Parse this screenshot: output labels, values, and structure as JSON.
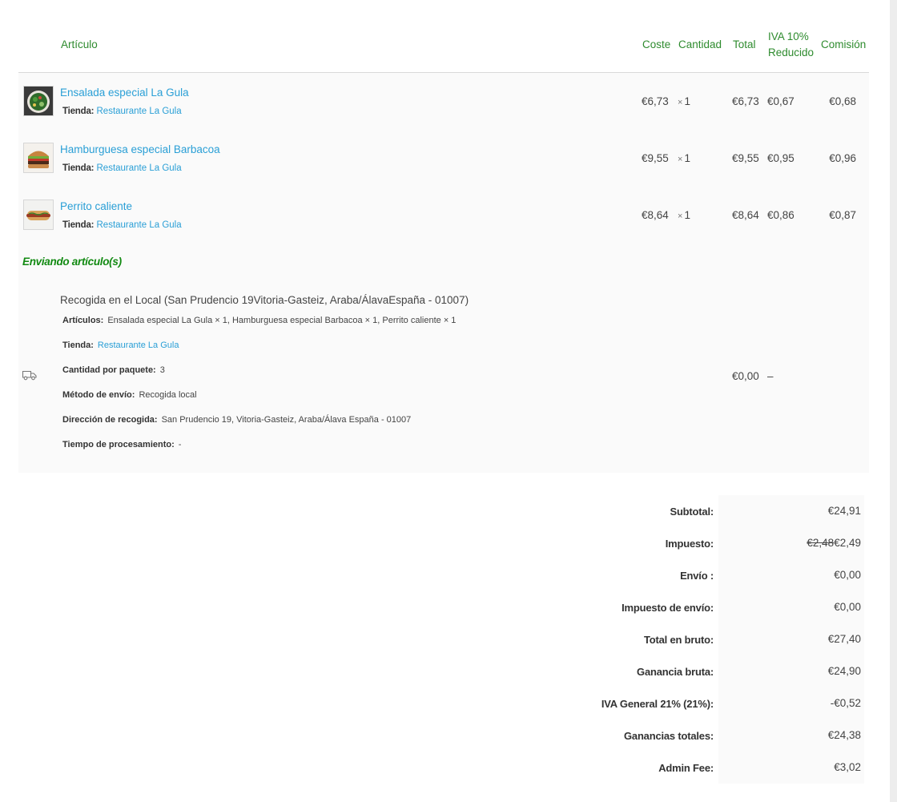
{
  "table": {
    "headers": {
      "item": "Artículo",
      "cost": "Coste",
      "quantity": "Cantidad",
      "total": "Total",
      "tax_line1": "IVA 10%",
      "tax_line2": "Reducido",
      "commission": "Comisión"
    },
    "store_label": "Tienda:",
    "qty_prefix": "×",
    "items": [
      {
        "name": "Ensalada especial La Gula",
        "store": "Restaurante La Gula",
        "cost": "€6,73",
        "qty": "1",
        "total": "€6,73",
        "tax": "€0,67",
        "commission": "€0,68",
        "thumb": "salad-thumbnail"
      },
      {
        "name": "Hamburguesa especial Barbacoa",
        "store": "Restaurante La Gula",
        "cost": "€9,55",
        "qty": "1",
        "total": "€9,55",
        "tax": "€0,95",
        "commission": "€0,96",
        "thumb": "burger-thumbnail"
      },
      {
        "name": "Perrito caliente",
        "store": "Restaurante La Gula",
        "cost": "€8,64",
        "qty": "1",
        "total": "€8,64",
        "tax": "€0,86",
        "commission": "€0,87",
        "thumb": "hotdog-thumbnail"
      }
    ]
  },
  "shipping": {
    "title": "Enviando artículo(s)",
    "icon": "truck-icon",
    "method_line": "Recogida en el Local (San Prudencio 19Vitoria-Gasteiz, Araba/ÁlavaEspaña - 01007)",
    "articles_label": "Artículos:",
    "articles_value": "Ensalada especial La Gula × 1, Hamburguesa especial Barbacoa × 1, Perrito caliente × 1",
    "store_label": "Tienda:",
    "store_value": "Restaurante La Gula",
    "qty_label": "Cantidad por paquete:",
    "qty_value": "3",
    "method_label": "Método de envío:",
    "method_value": "Recogida local",
    "address_label": "Dirección de recogida:",
    "address_value": "San Prudencio 19, Vitoria-Gasteiz, Araba/Álava España - 01007",
    "processing_label": "Tiempo de procesamiento:",
    "processing_value": "-",
    "total": "€0,00",
    "tax": "–"
  },
  "totals": {
    "subtotal_label": "Subtotal:",
    "subtotal": "€24,91",
    "tax_label": "Impuesto:",
    "tax_old": "€2,48",
    "tax_new": "€2,49",
    "shipping_label": "Envío :",
    "shipping": "€0,00",
    "shipping_tax_label": "Impuesto de envío:",
    "shipping_tax": "€0,00",
    "gross_label": "Total en bruto:",
    "gross": "€27,40",
    "gross_profit_label": "Ganancia bruta:",
    "gross_profit": "€24,90",
    "vat_label": "IVA General 21% (21%):",
    "vat": "-€0,52",
    "earnings_label": "Ganancias totales:",
    "earnings": "€24,38",
    "admin_fee_label": "Admin Fee:",
    "admin_fee": "€3,02"
  }
}
